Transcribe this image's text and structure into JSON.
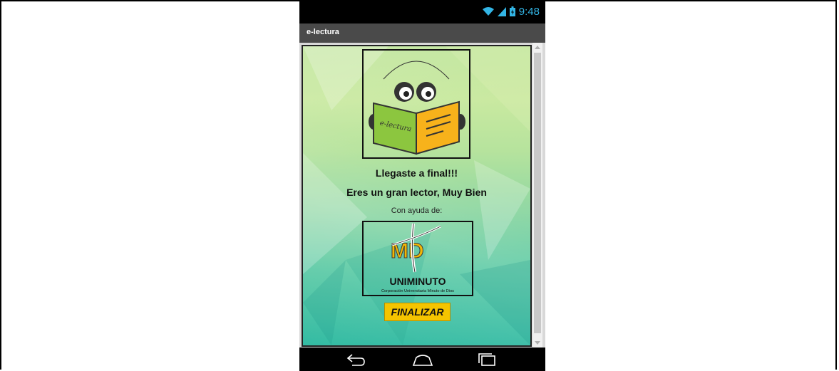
{
  "status_bar": {
    "time": "9:48"
  },
  "action_bar": {
    "title": "e-lectura"
  },
  "logo": {
    "book_text": "e-lectura"
  },
  "messages": {
    "line1": "Llegaste a final!!!",
    "line2": "Eres un gran lector, Muy Bien",
    "credit": "Con ayuda de:"
  },
  "sponsor": {
    "letters": "MD",
    "name": "UNIMINUTO",
    "tagline": "Corporación Universitaria Minuto de Dios"
  },
  "buttons": {
    "finish": "FINALIZAR"
  },
  "navigation": {
    "back": "back-icon",
    "home": "home-icon",
    "recents": "recents-icon"
  },
  "colors": {
    "accent": "#33b5e5",
    "button": "#f5c400",
    "book_left": "#8cc63f",
    "book_right": "#f7b21b"
  }
}
